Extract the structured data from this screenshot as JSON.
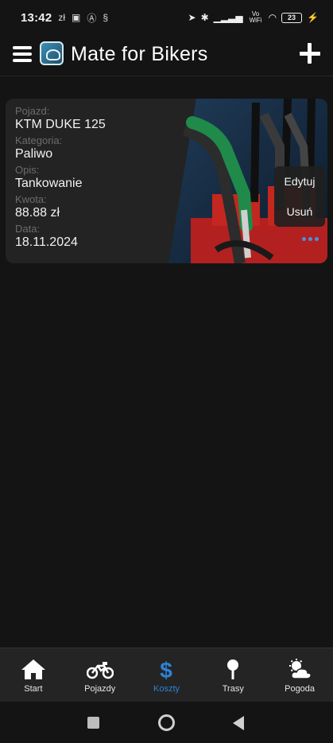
{
  "status_bar": {
    "time": "13:42",
    "left_icons": [
      "zl-icon",
      "nfc-icon",
      "a-icon",
      "s-icon"
    ],
    "right_icons": [
      "location-icon",
      "bluetooth-icon",
      "signal-icon",
      "vowifi-icon",
      "wifi-icon",
      "battery-icon"
    ],
    "vowifi": "Vo WiFi",
    "battery": "23"
  },
  "header": {
    "title": "Mate for Bikers",
    "menu_icon": "hamburger-menu-icon",
    "add_icon": "plus-icon"
  },
  "cost_entry": {
    "vehicle_label": "Pojazd:",
    "vehicle": "KTM  DUKE 125",
    "category_label": "Kategoria:",
    "category": "Paliwo",
    "description_label": "Opis:",
    "description": "Tankowanie",
    "amount_label": "Kwota:",
    "amount": "88.88 zł",
    "date_label": "Data:",
    "date": "18.11.2024",
    "image": "fuel-pump-photo"
  },
  "context_menu": {
    "edit": "Edytuj",
    "delete": "Usuń"
  },
  "bottom_nav": {
    "items": [
      {
        "label": "Start",
        "icon": "home-icon"
      },
      {
        "label": "Pojazdy",
        "icon": "motorcycle-icon"
      },
      {
        "label": "Koszty",
        "icon": "dollar-icon"
      },
      {
        "label": "Trasy",
        "icon": "map-pin-icon"
      },
      {
        "label": "Pogoda",
        "icon": "weather-icon"
      }
    ],
    "active_index": 2,
    "active_color": "#2f82d6"
  },
  "system_nav": {
    "buttons": [
      "recent-apps-icon",
      "home-circle-icon",
      "back-icon"
    ]
  }
}
